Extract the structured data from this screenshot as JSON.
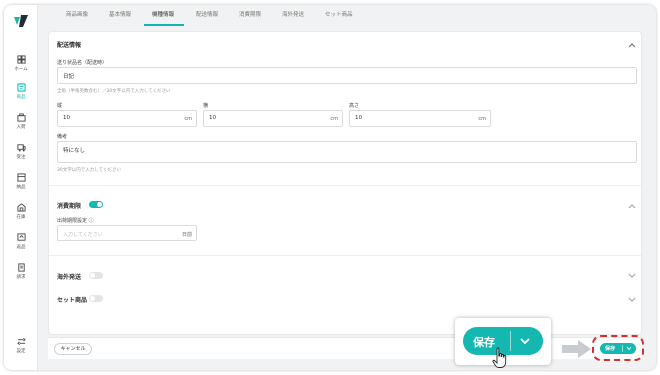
{
  "sidebar": {
    "items": [
      {
        "label": "ホーム",
        "icon": "home-icon"
      },
      {
        "label": "商品",
        "icon": "product-icon"
      },
      {
        "label": "入荷",
        "icon": "arrival-icon"
      },
      {
        "label": "受注",
        "icon": "order-icon"
      },
      {
        "label": "納品",
        "icon": "delivery-icon"
      },
      {
        "label": "在庫",
        "icon": "inventory-icon"
      },
      {
        "label": "返品",
        "icon": "return-icon"
      },
      {
        "label": "請求",
        "icon": "invoice-icon"
      },
      {
        "label": "設定",
        "icon": "settings-icon"
      }
    ],
    "active_index": 1
  },
  "tabs": [
    {
      "label": "商品画像"
    },
    {
      "label": "基本情報"
    },
    {
      "label": "機種情報"
    },
    {
      "label": "配送情報"
    },
    {
      "label": "消費期限"
    },
    {
      "label": "海外発送"
    },
    {
      "label": "セット商品"
    }
  ],
  "active_tab": 2,
  "shipping": {
    "title": "配送情報",
    "contents_label": "送り状品名（配送時）",
    "contents_value": "日記",
    "contents_hint": "全角（半角英数含む）／30文字以内で入力してください",
    "depth_label": "縦",
    "depth_value": "10",
    "width_label": "横",
    "width_value": "10",
    "height_label": "高さ",
    "height_value": "10",
    "unit": "cm",
    "notes_label": "備考",
    "notes_value": "特になし",
    "notes_hint": "30文字以内で入力してください"
  },
  "expiry": {
    "title": "消費期限",
    "enabled": true,
    "limit_label": "出荷期限設定 ⓘ",
    "limit_placeholder": "入力してください",
    "limit_unit": "日前"
  },
  "overseas": {
    "title": "海外発送",
    "enabled": false
  },
  "set_product": {
    "title": "セット商品",
    "enabled": false
  },
  "footer": {
    "cancel_label": "キャンセル"
  },
  "zoom": {
    "save_label": "保存"
  },
  "small_save": {
    "label": "保存"
  },
  "colors": {
    "accent": "#14b8b0",
    "highlight": "#d32f2f",
    "toggle_off": "#e2e4e7"
  }
}
